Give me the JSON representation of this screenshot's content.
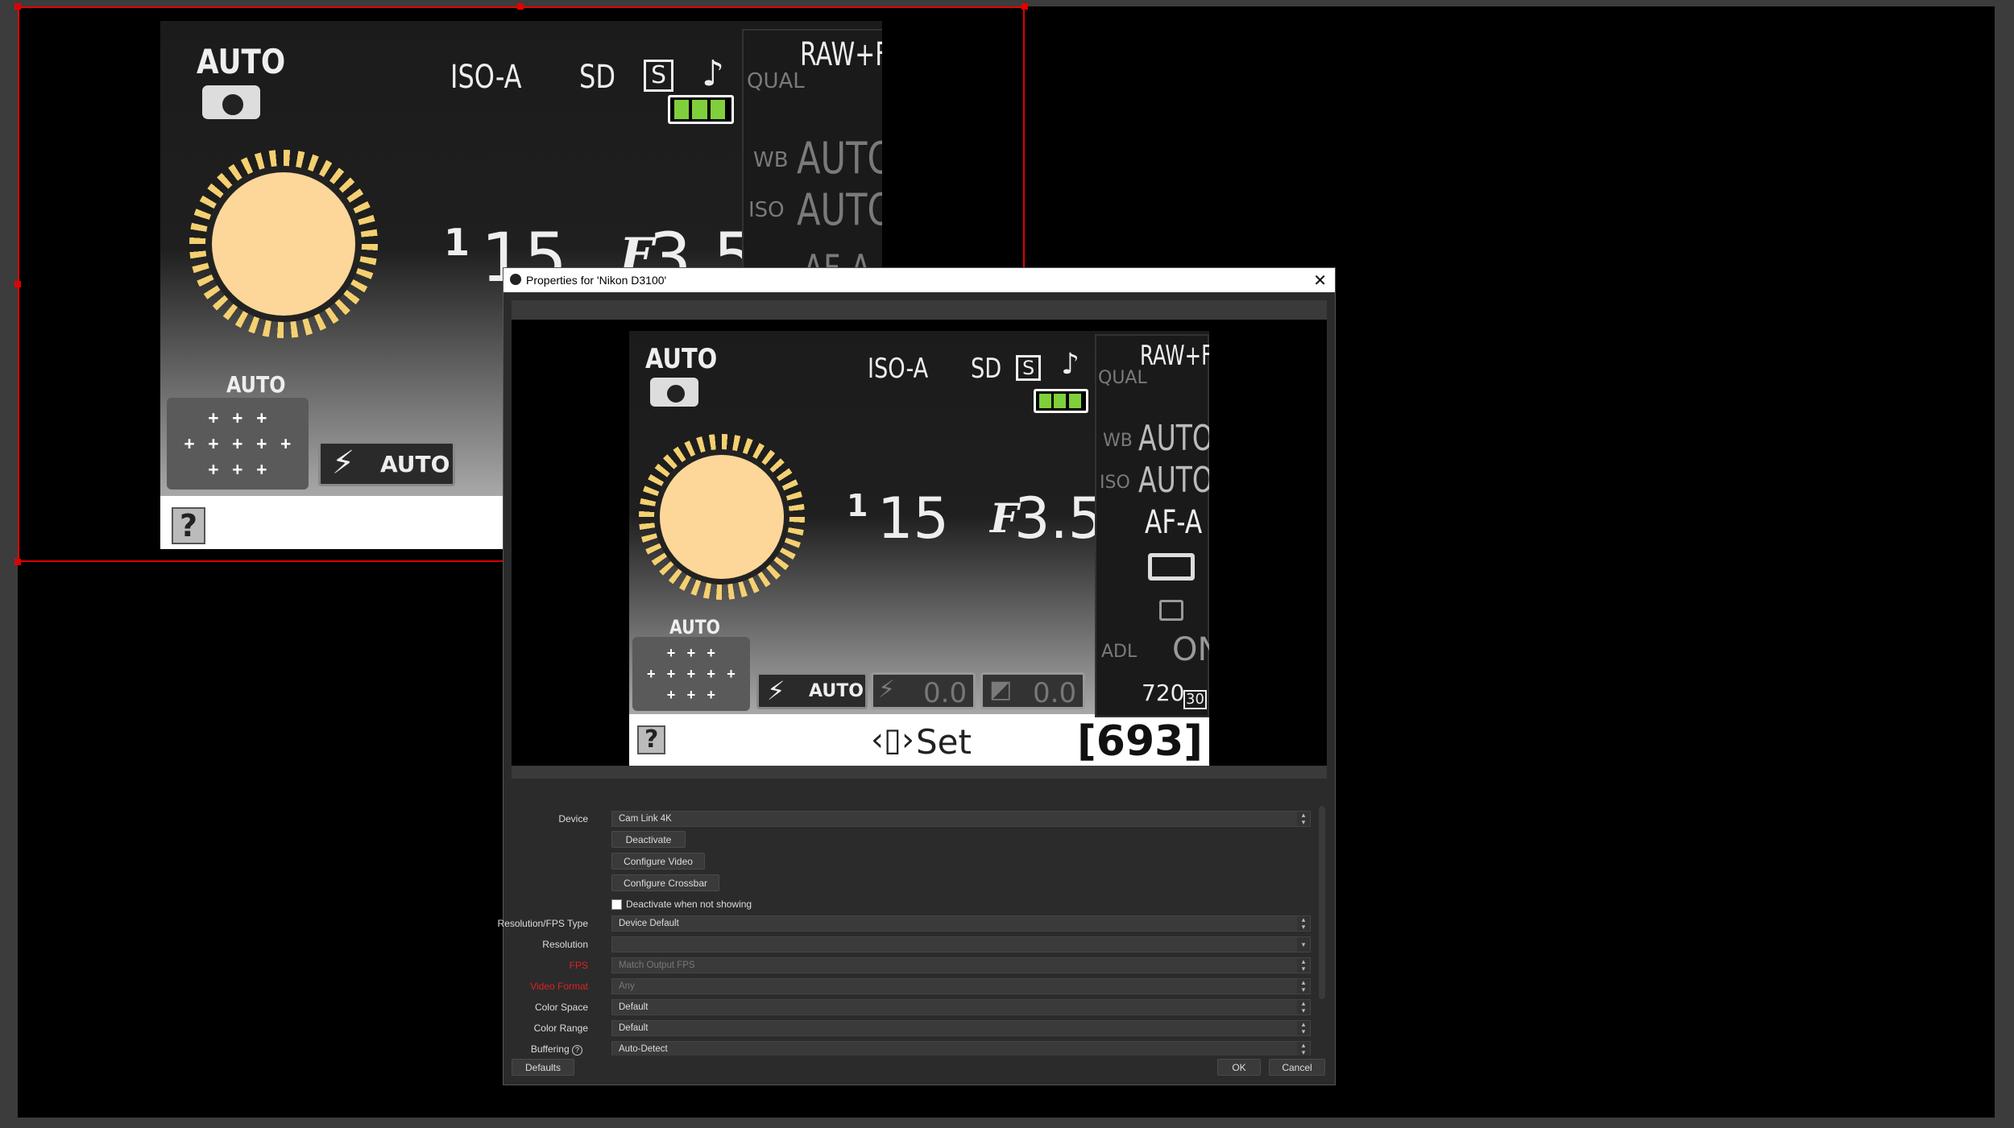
{
  "camera": {
    "mode": "AUTO",
    "iso_setting": "ISO-A",
    "picture_control": "SD",
    "release_mode": "S",
    "qual_label": "QUAL",
    "qual_value": "RAW+F",
    "wb_label": "WB",
    "wb_value": "AUTO",
    "iso_label": "ISO",
    "iso_value": "AUTO",
    "af_mode": "AF-A",
    "adl_label": "ADL",
    "adl_value": "ON",
    "movie_res": "720",
    "movie_fps": "30",
    "shutter_num": "1",
    "shutter_den": "15",
    "aperture_f": "F",
    "aperture_value": "3.5",
    "af_area_label": "AUTO",
    "flash_value": "AUTO",
    "flash_comp": "0.0",
    "exposure_comp": "0.0",
    "help": "?",
    "set_label": "Set",
    "shots_remaining": "[693]",
    "battery_fraction": 1.0
  },
  "dialog": {
    "title": "Properties for 'Nikon D3100'",
    "device_label": "Device",
    "device_value": "Cam Link 4K",
    "deactivate_button": "Deactivate",
    "configure_video_button": "Configure Video",
    "configure_crossbar_button": "Configure Crossbar",
    "deactivate_when_not_showing": "Deactivate when not showing",
    "resolution_fps_label": "Resolution/FPS Type",
    "resolution_fps_value": "Device Default",
    "resolution_label": "Resolution",
    "resolution_value": "",
    "fps_label": "FPS",
    "fps_value": "Match Output FPS",
    "video_format_label": "Video Format",
    "video_format_value": "Any",
    "color_space_label": "Color Space",
    "color_space_value": "Default",
    "color_range_label": "Color Range",
    "color_range_value": "Default",
    "buffering_label": "Buffering",
    "buffering_value": "Auto-Detect",
    "defaults_button": "Defaults",
    "ok_button": "OK",
    "cancel_button": "Cancel"
  },
  "colors": {
    "selection": "#e00000",
    "dial": "#fdd799",
    "battery": "#7fcf3c"
  }
}
